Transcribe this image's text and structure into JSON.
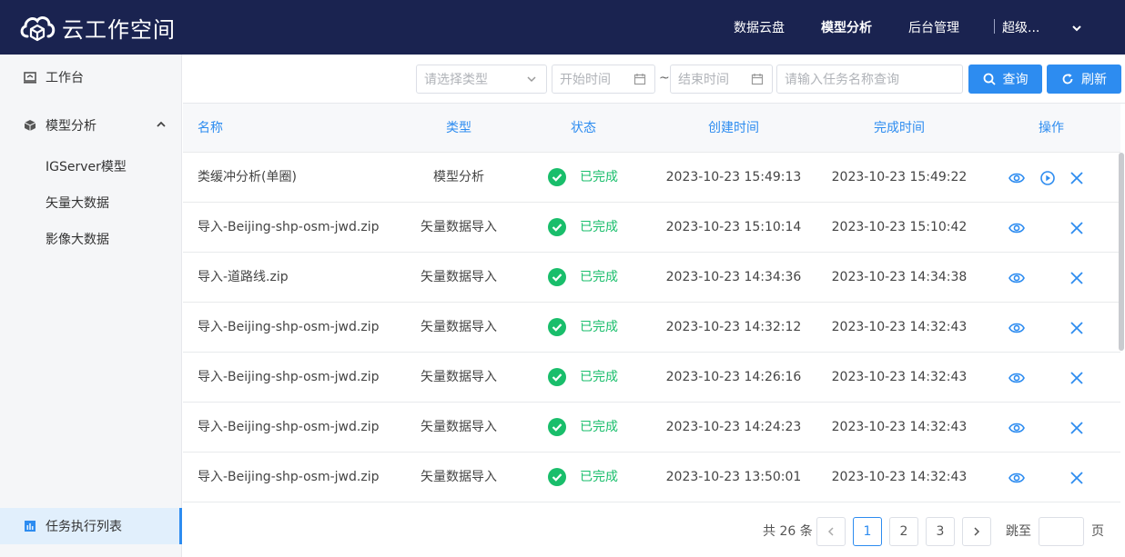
{
  "app": {
    "title": "云工作空间"
  },
  "nav": {
    "items": [
      "数据云盘",
      "模型分析",
      "后台管理"
    ],
    "active": "模型分析",
    "user": "超级..."
  },
  "sidebar": {
    "workbench": "工作台",
    "model_analysis": "模型分析",
    "sub_items": [
      "IGServer模型",
      "矢量大数据",
      "影像大数据"
    ],
    "task_list": "任务执行列表"
  },
  "toolbar": {
    "type_placeholder": "请选择类型",
    "start_placeholder": "开始时间",
    "separator": "~",
    "end_placeholder": "结束时间",
    "name_placeholder": "请输入任务名称查询",
    "query_label": "查询",
    "refresh_label": "刷新"
  },
  "table": {
    "columns": [
      "名称",
      "类型",
      "状态",
      "创建时间",
      "完成时间",
      "操作"
    ],
    "rows": [
      {
        "name": "类缓冲分析(单圈)",
        "type": "模型分析",
        "status": "已完成",
        "created": "2023-10-23 15:49:13",
        "finished": "2023-10-23 15:49:22",
        "has_play": true
      },
      {
        "name": "导入-Beijing-shp-osm-jwd.zip",
        "type": "矢量数据导入",
        "status": "已完成",
        "created": "2023-10-23 15:10:14",
        "finished": "2023-10-23 15:10:42",
        "has_play": false
      },
      {
        "name": "导入-道路线.zip",
        "type": "矢量数据导入",
        "status": "已完成",
        "created": "2023-10-23 14:34:36",
        "finished": "2023-10-23 14:34:38",
        "has_play": false
      },
      {
        "name": "导入-Beijing-shp-osm-jwd.zip",
        "type": "矢量数据导入",
        "status": "已完成",
        "created": "2023-10-23 14:32:12",
        "finished": "2023-10-23 14:32:43",
        "has_play": false
      },
      {
        "name": "导入-Beijing-shp-osm-jwd.zip",
        "type": "矢量数据导入",
        "status": "已完成",
        "created": "2023-10-23 14:26:16",
        "finished": "2023-10-23 14:32:43",
        "has_play": false
      },
      {
        "name": "导入-Beijing-shp-osm-jwd.zip",
        "type": "矢量数据导入",
        "status": "已完成",
        "created": "2023-10-23 14:24:23",
        "finished": "2023-10-23 14:32:43",
        "has_play": false
      },
      {
        "name": "导入-Beijing-shp-osm-jwd.zip",
        "type": "矢量数据导入",
        "status": "已完成",
        "created": "2023-10-23 13:50:01",
        "finished": "2023-10-23 14:32:43",
        "has_play": false
      }
    ]
  },
  "pagination": {
    "total": "共 26 条",
    "pages": [
      "1",
      "2",
      "3"
    ],
    "current": "1",
    "jump_label": "跳至",
    "page_suffix": "页"
  },
  "colors": {
    "accent": "#2d8cf0",
    "header_bg": "#1a2350",
    "success": "#19be6b",
    "sidebar_bg": "#f5f6f8"
  }
}
